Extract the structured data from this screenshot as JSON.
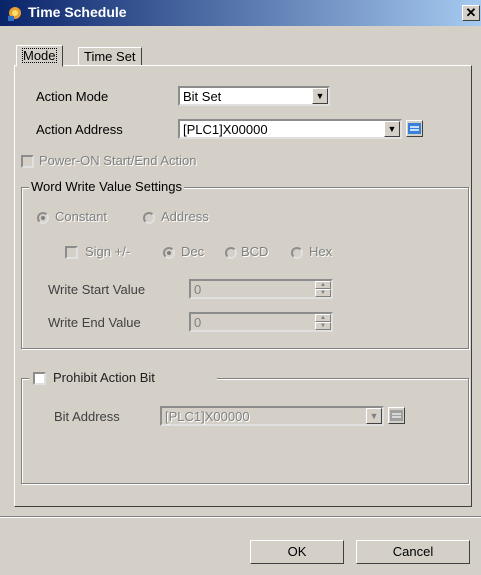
{
  "window": {
    "title": "Time Schedule",
    "close_label": "✕"
  },
  "tabs": [
    {
      "label": "Mode"
    },
    {
      "label": "Time Set"
    }
  ],
  "mode": {
    "action_mode": {
      "label": "Action Mode",
      "value": "Bit Set"
    },
    "action_address": {
      "label": "Action Address",
      "value": "[PLC1]X00000"
    },
    "power_on": {
      "label": "Power-ON Start/End Action",
      "checked": false
    }
  },
  "word_write": {
    "title": "Word Write Value Settings",
    "constant": "Constant",
    "address": "Address",
    "sign": "Sign +/-",
    "dec": "Dec",
    "bcd": "BCD",
    "hex": "Hex",
    "write_start": {
      "label": "Write Start Value",
      "value": "0"
    },
    "write_end": {
      "label": "Write End Value",
      "value": "0"
    }
  },
  "prohibit": {
    "label": "Prohibit Action Bit",
    "bit_address_label": "Bit Address",
    "bit_address_value": "[PLC1]X00000"
  },
  "buttons": {
    "ok": "OK",
    "cancel": "Cancel"
  },
  "icons": [
    "app-icon",
    "close-icon",
    "dropdown-arrow-icon",
    "address-picker-icon",
    "spin-up-icon",
    "spin-down-icon"
  ]
}
